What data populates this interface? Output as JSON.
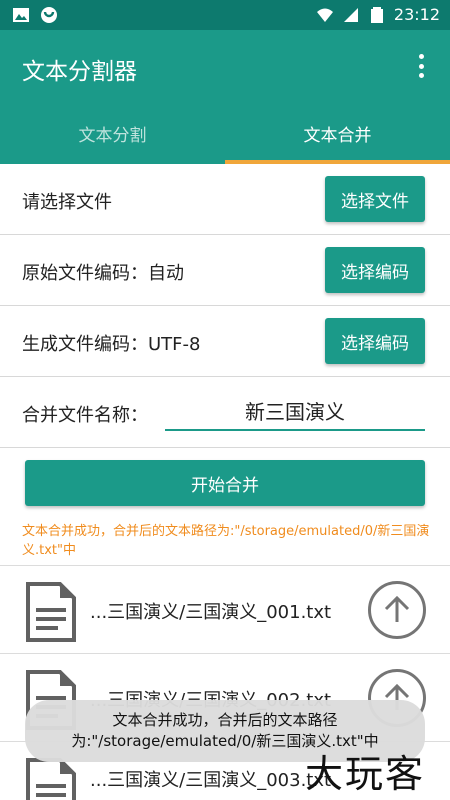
{
  "status_bar": {
    "time": "23:12",
    "icons": [
      "image-icon",
      "notification-icon",
      "wifi-icon",
      "signal-icon",
      "battery-icon"
    ]
  },
  "app_bar": {
    "title": "文本分割器",
    "overflow_icon": "more-vertical-icon"
  },
  "tabs": [
    {
      "label": "文本分割",
      "active": false
    },
    {
      "label": "文本合并",
      "active": true
    }
  ],
  "rows": {
    "select_file": {
      "label": "请选择文件",
      "button": "选择文件"
    },
    "source_encoding": {
      "label": "原始文件编码：自动",
      "button": "选择编码"
    },
    "target_encoding": {
      "label": "生成文件编码：UTF-8",
      "button": "选择编码"
    },
    "merge_name": {
      "label": "合并文件名称：",
      "value": "新三国演义"
    }
  },
  "merge_button": "开始合并",
  "result_message": "文本合并成功，合并后的文本路径为:\"/storage/emulated/0/新三国演义.txt\"中",
  "files": [
    {
      "name": "...三国演义/三国演义_001.txt"
    },
    {
      "name": "...三国演义/三国演义_002.txt"
    },
    {
      "name": "...三国演义/三国演义_003.txt"
    }
  ],
  "toast": "文本合并成功，合并后的文本路径为:\"/storage/emulated/0/新三国演义.txt\"中",
  "watermark": "大玩客",
  "colors": {
    "status_bar": "#0d7a6e",
    "primary": "#1b9a89",
    "tab_indicator": "#f0a63a",
    "result_text": "#f08c1e"
  }
}
